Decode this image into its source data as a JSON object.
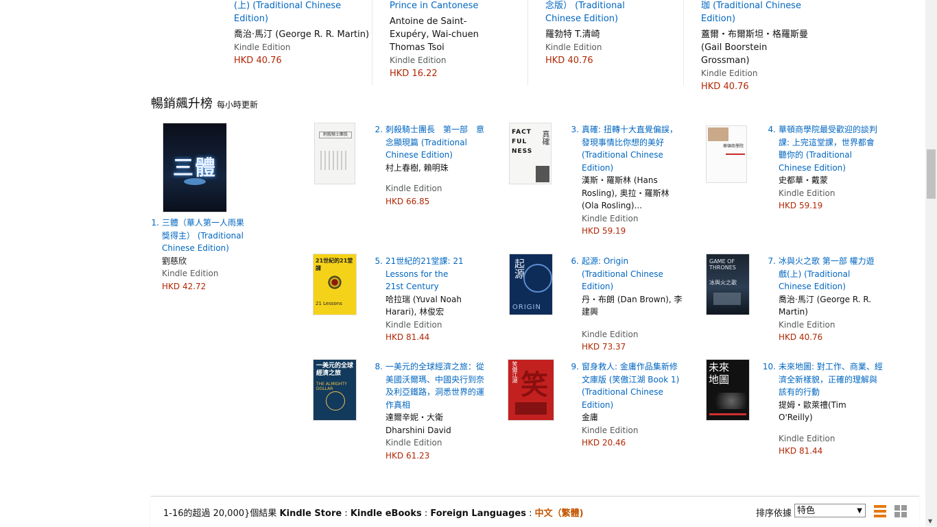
{
  "top_row": [
    {
      "title": "(上) (Traditional Chinese Edition)",
      "author": "喬治·馬汀 (George R. R. Martin)",
      "format": "Kindle Edition",
      "price": "HKD 40.76"
    },
    {
      "title": "Prince in Cantonese",
      "author": "Antoine de Saint-Exupéry, Wai-chuen Thomas Tsoi",
      "format": "Kindle Edition",
      "price": "HKD 16.22"
    },
    {
      "title": "念版） (Traditional Chinese Edition)",
      "author": "羅勃特 T.清崎",
      "format": "Kindle Edition",
      "price": "HKD 40.76"
    },
    {
      "title": "珈 (Traditional Chinese Edition)",
      "author": "蓋爾・布爾斯坦・格羅斯曼 (Gail Boorstein Grossman)",
      "format": "Kindle Edition",
      "price": "HKD 40.76"
    }
  ],
  "heading": {
    "title": "暢銷飆升榜",
    "subtitle": "每小時更新"
  },
  "items": [
    {
      "rank": "1.",
      "title": "三體（華人第一人雨果獎得主） (Traditional Chinese Edition)",
      "author": "劉慈欣",
      "format": "Kindle Edition",
      "price": "HKD 42.72",
      "cover_text": "三體"
    },
    {
      "rank": "2.",
      "title": "刺殺騎士團長　第一部　意念顯現篇 (Traditional Chinese Edition)",
      "author": "村上春樹, 賴明珠",
      "format": "Kindle Edition",
      "price": "HKD 66.85",
      "cover_text": "刺殺騎士團長"
    },
    {
      "rank": "3.",
      "title": "真確: 扭轉十大直覺偏誤，發現事情比你想的美好 (Traditional Chinese Edition)",
      "author": "漢斯・羅斯林 (Hans Rosling), 奥拉・羅斯林 (Ola Rosling)...",
      "format": "Kindle Edition",
      "price": "HKD 59.19",
      "cover_text": "FACT FUL NESS"
    },
    {
      "rank": "4.",
      "title": "華頓商學院最受歡迎的談判課: 上完這堂課，世界都會聽你的 (Traditional Chinese Edition)",
      "author": "史都華・戴蒙",
      "format": "Kindle Edition",
      "price": "HKD 59.19",
      "cover_text": "華頓商學院"
    },
    {
      "rank": "5.",
      "title": "21世紀的21堂課: 21 Lessons for the 21st Century",
      "author": "哈拉瑞 (Yuval Noah Harari), 林俊宏",
      "format": "Kindle Edition",
      "price": "HKD 81.44",
      "cover_text": "21世紀的21堂課"
    },
    {
      "rank": "6.",
      "title": "起源: Origin (Traditional Chinese Edition)",
      "author": "丹・布朗 (Dan Brown), 李建興",
      "format": "Kindle Edition",
      "price": "HKD 73.37",
      "cover_text": "起源"
    },
    {
      "rank": "7.",
      "title": "冰與火之歌 第一部 權力遊戲(上) (Traditional Chinese Edition)",
      "author": "喬治·馬汀 (George R. R. Martin)",
      "format": "Kindle Edition",
      "price": "HKD 40.76",
      "cover_text": "GAME OF THRONES"
    },
    {
      "rank": "8.",
      "title": "一美元的全球經濟之旅：從美國沃爾瑪、中國央行到奈及利亞鐵路，洞悉世界的運作真相",
      "author": "達爾辛妮・大衛Dharshini David",
      "format": "Kindle Edition",
      "price": "HKD 61.23",
      "cover_text": "一美元的全球經濟之旅"
    },
    {
      "rank": "9.",
      "title": "笑傲江湖 Book 1 (Traditional Chinese Edition)",
      "title_prefix": "窗身救人: 金庸作品集新修文庫版 (笑傲江湖 Book 1) (Traditional Chinese Edition)",
      "author": "金庸",
      "format": "Kindle Edition",
      "price": "HKD 20.46",
      "cover_text": "笑"
    },
    {
      "rank": "10.",
      "title": "未來地圖: 對工作、商業、經濟全新樣貌，正確的理解與該有的行動",
      "author": "提姆・歐萊禮(Tim O'Reilly)",
      "format": "Kindle Edition",
      "price": "HKD 81.44",
      "cover_text": "未來地圖"
    }
  ],
  "bottom_bar": {
    "results": "1-16的超過 20,000}個結果",
    "store": "Kindle Store",
    "ebooks": "Kindle eBooks",
    "foreign": "Foreign Languages",
    "lang": "中文（繁體)",
    "sep": " : ",
    "sort_label": "排序依據",
    "sort_value": "特色"
  },
  "colors": {
    "link": "#0066c0",
    "price": "#b12704",
    "accent": "#e47911"
  }
}
